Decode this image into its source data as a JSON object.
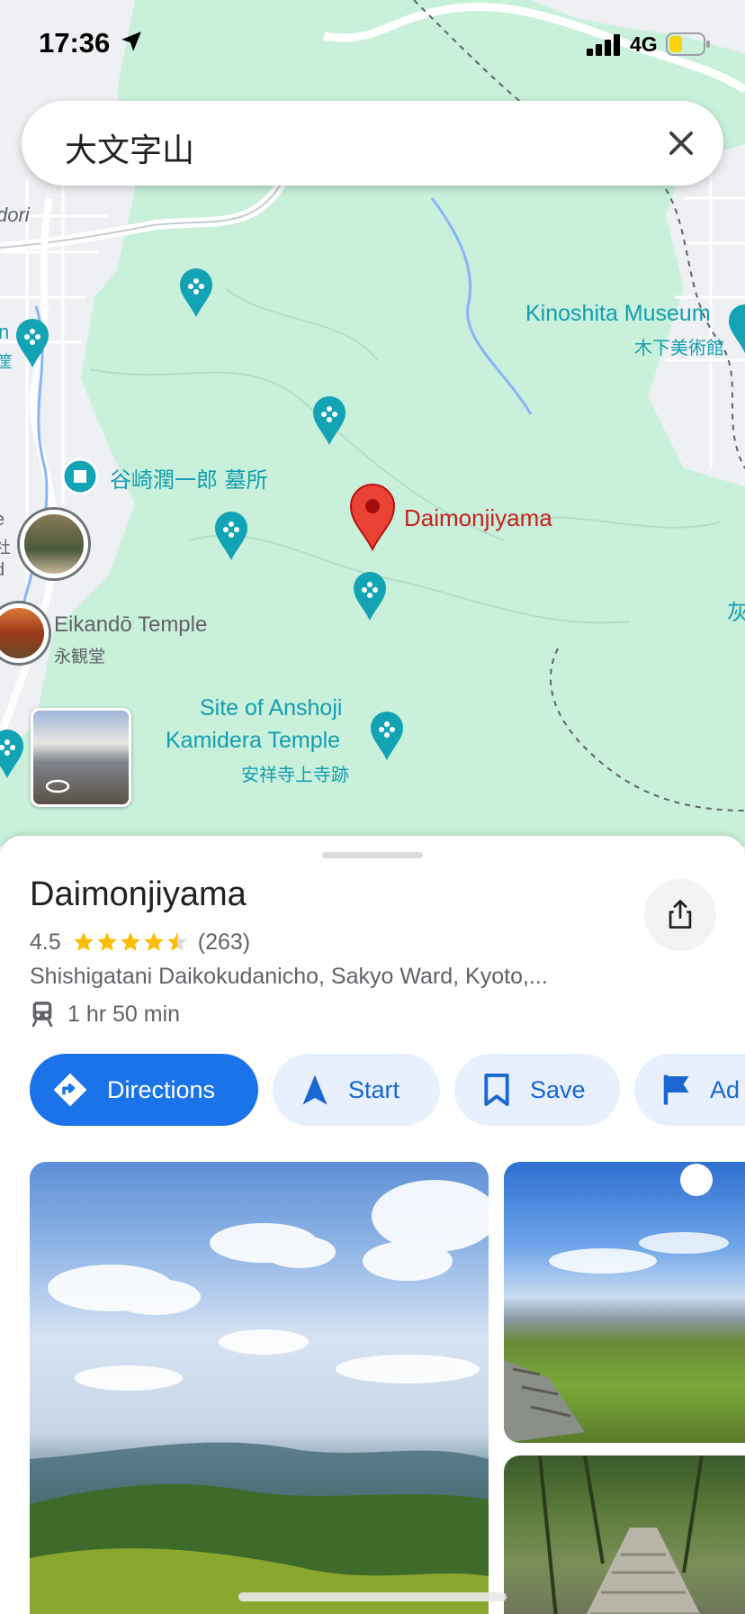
{
  "status_bar": {
    "time": "17:36",
    "network": "4G"
  },
  "search": {
    "query": "大文字山"
  },
  "map": {
    "labels": {
      "kinoshita_museum": "Kinoshita Museum",
      "kinoshita_museum_jp": "木下美術館",
      "tanizaki_grave": "谷崎潤一郎 墓所",
      "selected_place": "Daimonjiyama",
      "eikando": "Eikandō Temple",
      "eikando_jp": "永観堂",
      "anshoji_line1": "Site of Anshoji",
      "anshoji_line2": "Kamidera Temple",
      "anshoji_jp": "安祥寺上寺跡",
      "edge_dori": "dori",
      "edge_jp_right": "灰",
      "edge_jp_left": "筐",
      "edge_left_1": "n",
      "edge_left_2": "e",
      "edge_left_3": "社",
      "edge_left_4": "d"
    },
    "colors": {
      "poi": "#12a3b4",
      "selected_pin": "#ea4335",
      "map_bg": "#c9f0db"
    }
  },
  "place": {
    "name": "Daimonjiyama",
    "rating": "4.5",
    "stars": 4.5,
    "review_count": "(263)",
    "address": "Shishigatani Daikokudanicho, Sakyo Ward, Kyoto,...",
    "transit_time": "1 hr 50 min"
  },
  "actions": {
    "directions": "Directions",
    "start": "Start",
    "save": "Save",
    "add": "Ad"
  },
  "icons": {
    "share": "share-icon",
    "directions": "directions-icon",
    "start": "navigation-arrow-icon",
    "save": "bookmark-icon",
    "add": "flag-icon",
    "transit": "train-icon",
    "clear": "close-icon"
  }
}
